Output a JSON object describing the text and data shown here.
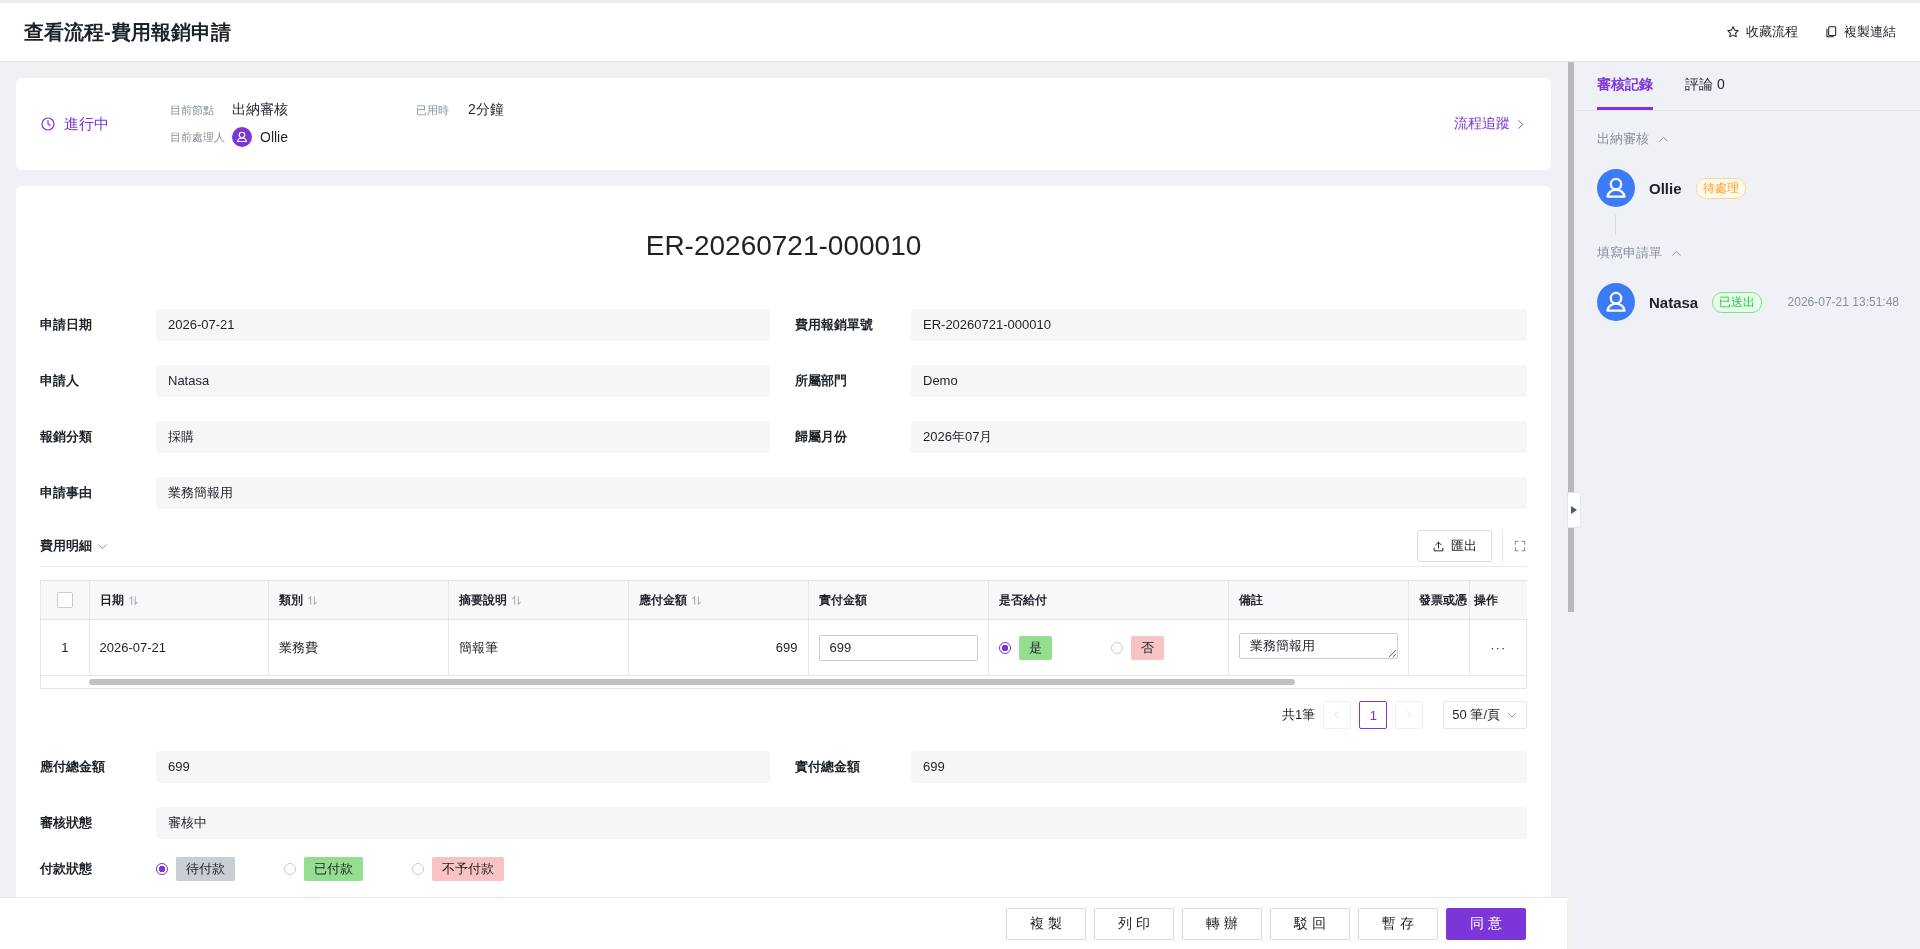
{
  "header": {
    "title": "查看流程-費用報銷申請",
    "actions": [
      {
        "label": "收藏流程"
      },
      {
        "label": "複製連結"
      }
    ]
  },
  "status_card": {
    "state": "進行中",
    "current_node_label": "目前節點",
    "current_node": "出納審核",
    "elapsed_label": "已用時",
    "elapsed": "2分鐘",
    "handler_label": "目前處理人",
    "handler": "Ollie",
    "trace_link": "流程追蹤"
  },
  "form": {
    "title": "ER-20260721-000010",
    "fields": [
      {
        "label": "申請日期",
        "value": "2026-07-21",
        "kind": "half"
      },
      {
        "label": "費用報銷單號",
        "value": "ER-20260721-000010",
        "kind": "half"
      },
      {
        "label": "申請人",
        "value": "Natasa",
        "kind": "half"
      },
      {
        "label": "所屬部門",
        "value": "Demo",
        "kind": "half"
      },
      {
        "label": "報銷分類",
        "value": "採購",
        "kind": "half"
      },
      {
        "label": "歸屬月份",
        "value": "2026年07月",
        "kind": "half"
      },
      {
        "label": "申請事由",
        "value": "業務簡報用",
        "kind": "wide"
      }
    ]
  },
  "details": {
    "title": "費用明細",
    "expanded": true,
    "export_button": "匯出",
    "select_all_checked": false,
    "columns": [
      {
        "label": "日期",
        "sortable": true
      },
      {
        "label": "類別",
        "sortable": true
      },
      {
        "label": "摘要說明",
        "sortable": true
      },
      {
        "label": "應付金額",
        "sortable": true
      },
      {
        "label": "實付金額",
        "sortable": false
      },
      {
        "label": "是否給付",
        "sortable": false
      },
      {
        "label": "備註",
        "sortable": false
      },
      {
        "label": "發票或憑"
      },
      {
        "label": "操作",
        "sortable": false
      }
    ],
    "rows": [
      {
        "index": "1",
        "date": "2026-07-21",
        "category": "業務費",
        "summary": "簡報筆",
        "payable": "699",
        "paid": "699",
        "pay_options": [
          {
            "label": "是",
            "selected": true,
            "color": "#95de8f"
          },
          {
            "label": "否",
            "selected": false,
            "color": "#f8c3c3"
          }
        ],
        "remark": "業務簡報用",
        "action": "···"
      }
    ],
    "pagination": {
      "total": "共1筆",
      "pages": [
        {
          "label": "1",
          "selected": true
        }
      ],
      "page_size": "50 筆/頁"
    }
  },
  "summary": {
    "fields": [
      {
        "label": "應付總金額",
        "value": "699",
        "kind": "half"
      },
      {
        "label": "實付總金額",
        "value": "699",
        "kind": "half"
      },
      {
        "label": "審核狀態",
        "value": "審核中",
        "kind": "wide"
      }
    ],
    "payment_status": {
      "label": "付款狀態",
      "options": [
        {
          "label": "待付款",
          "selected": true,
          "color": "#c9cdd4"
        },
        {
          "label": "已付款",
          "selected": false,
          "color": "#95de8f"
        },
        {
          "label": "不予付款",
          "selected": false,
          "color": "#f8c3c3"
        }
      ]
    }
  },
  "action_bar": [
    {
      "label": "複製",
      "kind": "default"
    },
    {
      "label": "列印",
      "kind": "default"
    },
    {
      "label": "轉辦",
      "kind": "default"
    },
    {
      "label": "駁回",
      "kind": "default"
    },
    {
      "label": "暫存",
      "kind": "default"
    },
    {
      "label": "同意",
      "kind": "primary"
    }
  ],
  "side_panel": {
    "tabs": [
      {
        "label": "審核記錄",
        "selected": true
      },
      {
        "label": "評論 0",
        "selected": false
      }
    ],
    "groups": [
      {
        "title": "出納審核",
        "expanded": true,
        "entries": [
          {
            "name": "Ollie",
            "status": "待處理",
            "kind": "pending"
          }
        ]
      },
      {
        "title": "填寫申請單",
        "expanded": true,
        "entries": [
          {
            "name": "Natasa",
            "status": "已送出",
            "kind": "done",
            "time": "2026-07-21 13:51:48"
          }
        ]
      }
    ]
  }
}
